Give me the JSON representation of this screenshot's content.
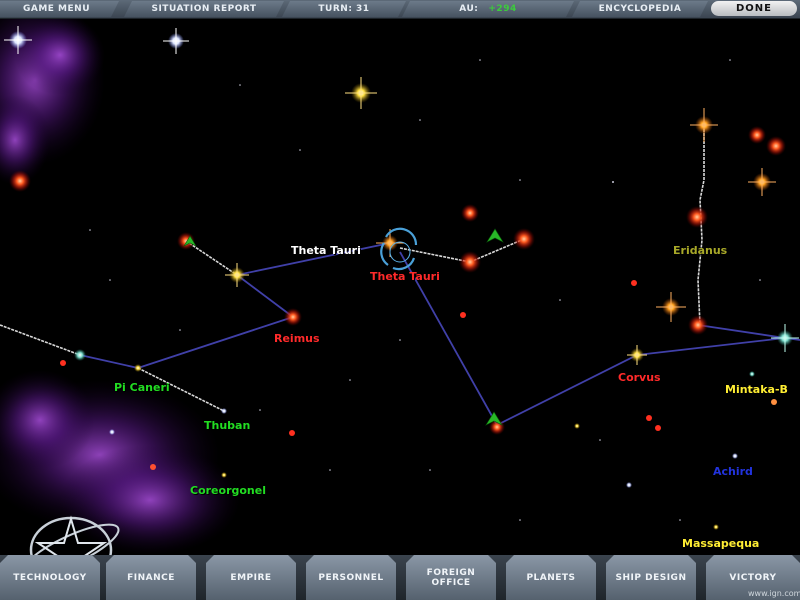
{
  "top_bar": {
    "game_menu": "GAME MENU",
    "situation_report": "SITUATION REPORT",
    "turn_label": "TURN: 31",
    "au_label": "AU:",
    "au_value": "+294",
    "encyclopedia": "ENCYCLOPEDIA",
    "done": "DONE"
  },
  "systems": {
    "theta_tauri_white": "Theta Tauri",
    "theta_tauri_red": "Theta Tauri",
    "eridanus": "Eridanus",
    "reimus": "Reimus",
    "pi_caneri": "Pi Caneri",
    "corvus": "Corvus",
    "mintaka_b": "Mintaka-B",
    "thuban": "Thuban",
    "achird": "Achird",
    "coreorgonel": "Coreorgonel",
    "massapequa": "Massapequa"
  },
  "colors": {
    "owned": "#ffffff",
    "enemy": "#ff2a2a",
    "ally": "#22dd22",
    "neutral_yellow": "#ffee33",
    "olive": "#a8a828",
    "blue": "#2233dd",
    "lane": "#4444aa"
  },
  "bottom_bar": {
    "technology": "TECHNOLOGY",
    "finance": "FINANCE",
    "empire": "EMPIRE",
    "personnel": "PERSONNEL",
    "foreign_office_1": "FOREIGN",
    "foreign_office_2": "OFFICE",
    "planets": "PLANETS",
    "ship_design": "SHIP DESIGN",
    "victory": "VICTORY"
  },
  "credit": "www.ign.com"
}
